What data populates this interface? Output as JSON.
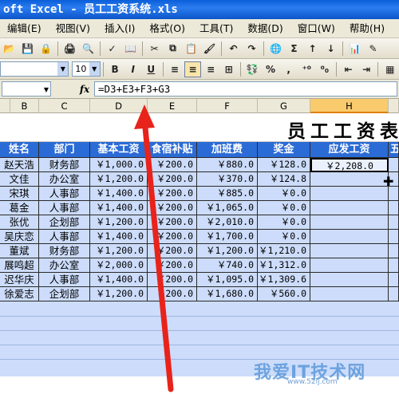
{
  "window": {
    "title": "oft Excel - 员工工资系统.xls"
  },
  "menu": [
    "编辑(E)",
    "视图(V)",
    "插入(I)",
    "格式(O)",
    "工具(T)",
    "数据(D)",
    "窗口(W)",
    "帮助(H)"
  ],
  "toolbar": {
    "font_size": "10",
    "bold": "B",
    "italic": "I",
    "underline": "U",
    "percent": "%",
    "comma": ","
  },
  "formula_bar": {
    "fx_label": "fx",
    "formula": "=D3+E3+F3+G3",
    "name_box": ""
  },
  "columns": [
    "B",
    "C",
    "D",
    "E",
    "F",
    "G",
    "H"
  ],
  "sheet": {
    "title": "员工工资表",
    "headers": [
      "姓名",
      "部门",
      "基本工资",
      "食宿补贴",
      "加班费",
      "奖金",
      "应发工资",
      "五"
    ],
    "rows": [
      [
        "赵天浩",
        "财务部",
        "￥1,000.0",
        "￥200.0",
        "￥880.0",
        "￥128.0",
        "￥2,208.0"
      ],
      [
        "文佳",
        "办公室",
        "￥1,200.0",
        "￥200.0",
        "￥370.0",
        "￥124.8",
        ""
      ],
      [
        "宋琪",
        "人事部",
        "￥1,400.0",
        "￥200.0",
        "￥885.0",
        "￥0.0",
        ""
      ],
      [
        "葛金",
        "人事部",
        "￥1,400.0",
        "￥200.0",
        "￥1,065.0",
        "￥0.0",
        ""
      ],
      [
        "张优",
        "企划部",
        "￥1,200.0",
        "￥200.0",
        "￥2,010.0",
        "￥0.0",
        ""
      ],
      [
        "吴庆恋",
        "人事部",
        "￥1,400.0",
        "￥200.0",
        "￥1,700.0",
        "￥0.0",
        ""
      ],
      [
        "董斌",
        "财务部",
        "￥1,200.0",
        "￥200.0",
        "￥1,200.0",
        "￥1,210.0",
        ""
      ],
      [
        "展鸣超",
        "办公室",
        "￥2,000.0",
        "￥200.0",
        "￥740.0",
        "￥1,312.0",
        ""
      ],
      [
        "迟华庆",
        "人事部",
        "￥1,400.0",
        "￥200.0",
        "￥1,095.0",
        "￥1,309.6",
        ""
      ],
      [
        "徐爱志",
        "企划部",
        "￥1,200.0",
        "￥200.0",
        "￥1,680.0",
        "￥560.0",
        ""
      ]
    ]
  },
  "watermark": {
    "text": "我爱IT技术网",
    "url": "www.52ij.com"
  },
  "colors": {
    "header_blue": "#2b6bd5",
    "cell_blue": "#ccdcfa",
    "arrow_red": "#e8231b"
  }
}
